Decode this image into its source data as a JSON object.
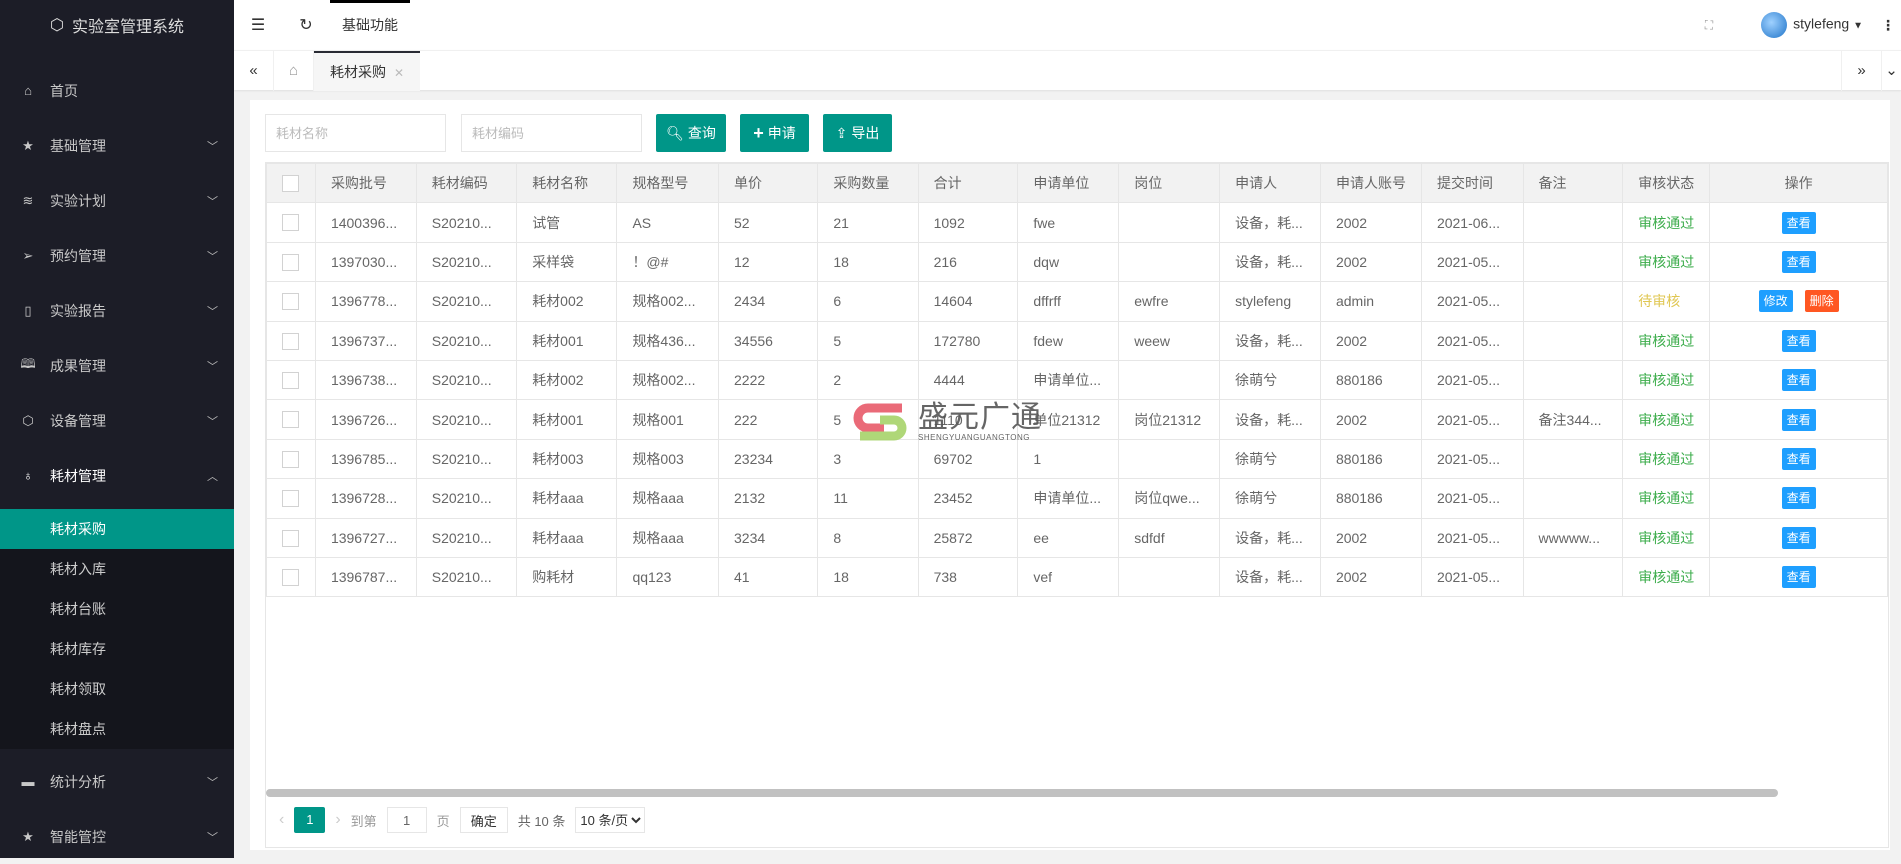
{
  "app": {
    "title": "实验室管理系统"
  },
  "sidebar": {
    "items": [
      {
        "label": "首页",
        "icon": "home-icon"
      },
      {
        "label": "基础管理",
        "icon": "star-icon"
      },
      {
        "label": "实验计划",
        "icon": "layers-icon"
      },
      {
        "label": "预约管理",
        "icon": "send-icon"
      },
      {
        "label": "实验报告",
        "icon": "note-icon"
      },
      {
        "label": "成果管理",
        "icon": "book-icon"
      },
      {
        "label": "设备管理",
        "icon": "cube-icon"
      },
      {
        "label": "耗材管理",
        "icon": "drops-icon"
      }
    ],
    "subitems": [
      "耗材采购",
      "耗材入库",
      "耗材台账",
      "耗材库存",
      "耗材领取",
      "耗材盘点"
    ],
    "bottom": [
      {
        "label": "统计分析",
        "icon": "chat-icon"
      },
      {
        "label": "智能管控",
        "icon": "star-icon"
      }
    ]
  },
  "topbar": {
    "func": "基础功能",
    "user": "stylefeng"
  },
  "tabs": {
    "active": "耗材采购"
  },
  "search": {
    "name_placeholder": "耗材名称",
    "code_placeholder": "耗材编码",
    "query": "查询",
    "apply": "申请",
    "export": "导出"
  },
  "table": {
    "headers": [
      "采购批号",
      "耗材编码",
      "耗材名称",
      "规格型号",
      "单价",
      "采购数量",
      "合计",
      "申请单位",
      "岗位",
      "申请人",
      "申请人账号",
      "提交时间",
      "备注",
      "审核状态",
      "操作"
    ],
    "rows": [
      [
        "1400396...",
        "S20210...",
        "试管",
        "AS",
        "52",
        "21",
        "1092",
        "fwe",
        "",
        "设备，耗...",
        "2002",
        "2021-06...",
        "",
        "审核通过"
      ],
      [
        "1397030...",
        "S20210...",
        "采样袋",
        "！@#",
        "12",
        "18",
        "216",
        "dqw",
        "",
        "设备，耗...",
        "2002",
        "2021-05...",
        "",
        "审核通过"
      ],
      [
        "1396778...",
        "S20210...",
        "耗材002",
        "规格002...",
        "2434",
        "6",
        "14604",
        "dffrff",
        "ewfre",
        "stylefeng",
        "admin",
        "2021-05...",
        "",
        "待审核"
      ],
      [
        "1396737...",
        "S20210...",
        "耗材001",
        "规格436...",
        "34556",
        "5",
        "172780",
        "fdew",
        "weew",
        "设备，耗...",
        "2002",
        "2021-05...",
        "",
        "审核通过"
      ],
      [
        "1396738...",
        "S20210...",
        "耗材002",
        "规格002...",
        "2222",
        "2",
        "4444",
        "申请单位...",
        "",
        "徐萌兮",
        "880186",
        "2021-05...",
        "",
        "审核通过"
      ],
      [
        "1396726...",
        "S20210...",
        "耗材001",
        "规格001",
        "222",
        "5",
        "1110",
        "单位21312",
        "岗位21312",
        "设备，耗...",
        "2002",
        "2021-05...",
        "备注344...",
        "审核通过"
      ],
      [
        "1396785...",
        "S20210...",
        "耗材003",
        "规格003",
        "23234",
        "3",
        "69702",
        "1",
        "",
        "徐萌兮",
        "880186",
        "2021-05...",
        "",
        "审核通过"
      ],
      [
        "1396728...",
        "S20210...",
        "耗材aaa",
        "规格aaa",
        "2132",
        "11",
        "23452",
        "申请单位...",
        "岗位qwe...",
        "徐萌兮",
        "880186",
        "2021-05...",
        "",
        "审核通过"
      ],
      [
        "1396727...",
        "S20210...",
        "耗材aaa",
        "规格aaa",
        "3234",
        "8",
        "25872",
        "ee",
        "sdfdf",
        "设备，耗...",
        "2002",
        "2021-05...",
        "wwwww...",
        "审核通过"
      ],
      [
        "1396787...",
        "S20210...",
        "购耗材",
        "qq123",
        "41",
        "18",
        "738",
        "vef",
        "",
        "设备，耗...",
        "2002",
        "2021-05...",
        "",
        "审核通过"
      ]
    ],
    "view": "查看",
    "edit": "修改",
    "delete": "删除"
  },
  "pager": {
    "current": "1",
    "goto": "到第",
    "page_value": "1",
    "page": "页",
    "confirm": "确定",
    "total": "共 10 条",
    "size": "10 条/页"
  },
  "watermark": {
    "name": "盛元广通",
    "pinyin": "SHENGYUANGUANGTONG"
  },
  "colors": {
    "primary": "#009688",
    "sidebar": "#1c1d27",
    "ok": "#3dad4c",
    "pending": "#e0c752",
    "view": "#1e9fff",
    "delete": "#ff5722"
  }
}
